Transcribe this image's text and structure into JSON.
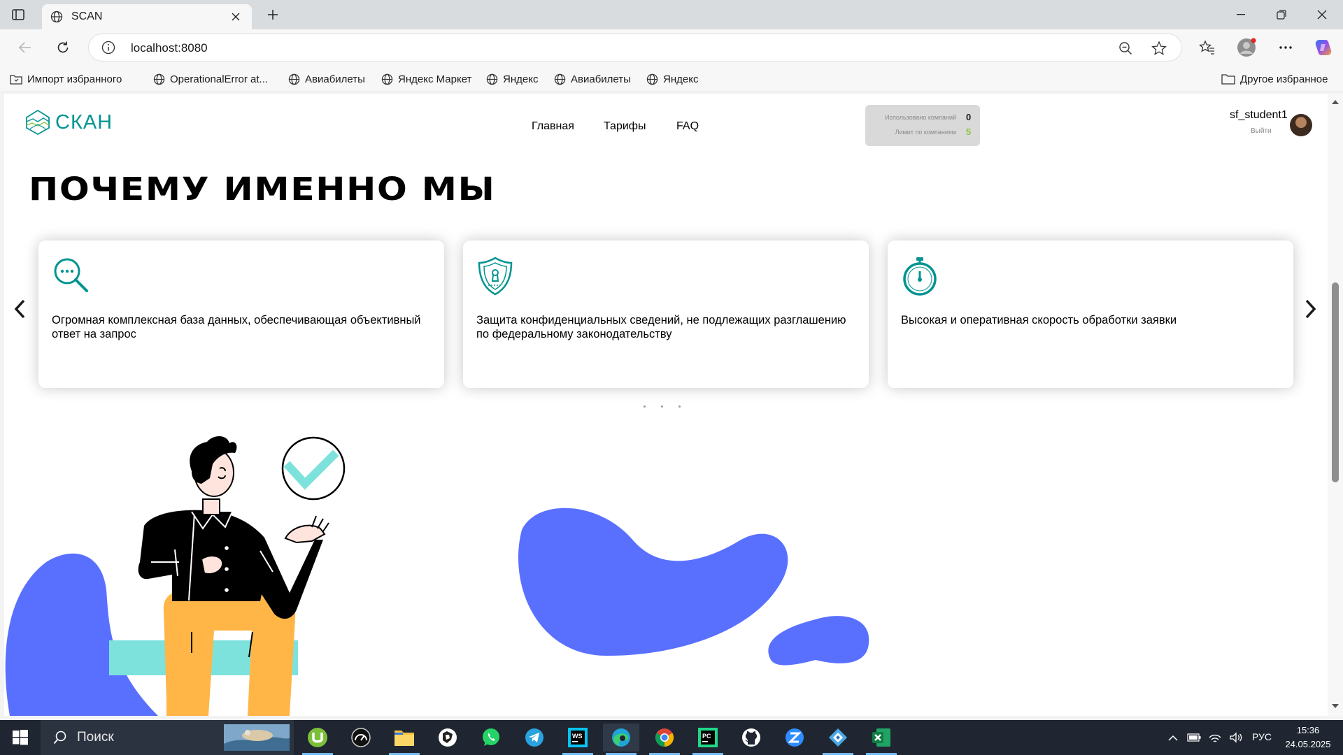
{
  "browser": {
    "tab_title": "SCAN",
    "address": "localhost:8080",
    "bookmarks": [
      "Импорт избранного",
      "OperationalError at...",
      "Авиабилеты",
      "Яндекс Маркет",
      "Яндекс",
      "Авиабилеты",
      "Яндекс"
    ],
    "other_favorites": "Другое избранное"
  },
  "header": {
    "logo": "СКАН",
    "menu": [
      "Главная",
      "Тарифы",
      "FAQ"
    ],
    "stats": {
      "used_label": "Использовано компаний",
      "used_value": "0",
      "limit_label": "Лимит по компаниям",
      "limit_value": "5",
      "limit_color": "#8AC540"
    },
    "user": {
      "name": "sf_student1",
      "logout": "Выйти"
    }
  },
  "main": {
    "section_title": "ПОЧЕМУ ИМЕННО МЫ",
    "cards": [
      {
        "icon": "magnifier-dots-icon",
        "text": "Огромная комплексная база данных, обеспечивающая объективный ответ на запрос"
      },
      {
        "icon": "shield-lock-icon",
        "text": "Защита конфиденциальных сведений, не подлежащих разглашению по федеральному законодательству"
      },
      {
        "icon": "stopwatch-icon",
        "text": "Высокая и оперативная скорость обработки заявки"
      }
    ],
    "accent_color": "#029491",
    "blob_color": "#5970FF"
  },
  "taskbar": {
    "search_placeholder": "Поиск",
    "language": "РУС",
    "time": "15:36",
    "date": "24.05.2025"
  }
}
